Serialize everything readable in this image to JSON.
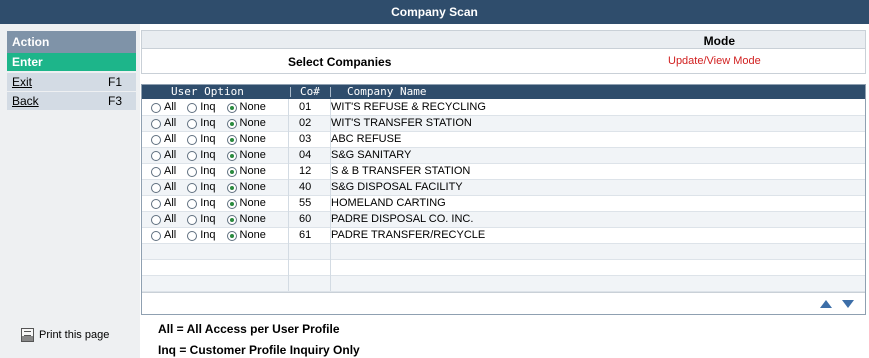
{
  "window": {
    "title": "Company Scan"
  },
  "actions": {
    "header": "Action",
    "enter": "Enter",
    "exit_label": "Exit",
    "exit_key": "F1",
    "back_label": "Back",
    "back_key": "F3",
    "print_label": "Print this page"
  },
  "mode": {
    "header": "Mode",
    "select_label": "Select Companies",
    "value": "Update/View Mode"
  },
  "grid": {
    "columns": [
      "User Option",
      "Co#",
      "Company Name"
    ],
    "option_labels": [
      "All",
      "Inq",
      "None"
    ],
    "rows": [
      {
        "co": "01",
        "name": "WIT'S REFUSE & RECYCLING",
        "selected": "None"
      },
      {
        "co": "02",
        "name": "WIT'S TRANSFER STATION",
        "selected": "None"
      },
      {
        "co": "03",
        "name": "ABC REFUSE",
        "selected": "None"
      },
      {
        "co": "04",
        "name": "S&G SANITARY",
        "selected": "None"
      },
      {
        "co": "12",
        "name": "S & B TRANSFER STATION",
        "selected": "None"
      },
      {
        "co": "40",
        "name": "S&G DISPOSAL FACILITY",
        "selected": "None"
      },
      {
        "co": "55",
        "name": "HOMELAND CARTING",
        "selected": "None"
      },
      {
        "co": "60",
        "name": "PADRE DISPOSAL CO. INC.",
        "selected": "None"
      },
      {
        "co": "61",
        "name": "PADRE TRANSFER/RECYCLE",
        "selected": "None"
      }
    ]
  },
  "legend": {
    "all": "All = All Access per User Profile",
    "inq": "Inq = Customer Profile Inquiry Only"
  },
  "colors": {
    "title_bar": "#2f4d6c",
    "enter_bg": "#1db58a",
    "mode_value": "#d11f1f",
    "scroll_arrows": "#3c6ea8"
  }
}
